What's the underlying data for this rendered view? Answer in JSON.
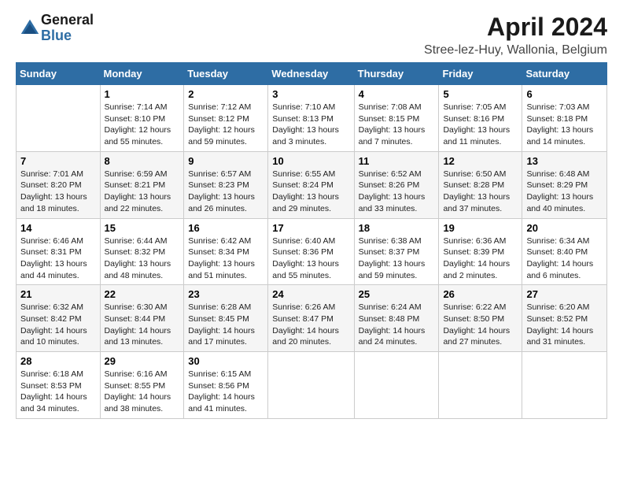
{
  "header": {
    "logo_general": "General",
    "logo_blue": "Blue",
    "title": "April 2024",
    "subtitle": "Stree-lez-Huy, Wallonia, Belgium"
  },
  "weekdays": [
    "Sunday",
    "Monday",
    "Tuesday",
    "Wednesday",
    "Thursday",
    "Friday",
    "Saturday"
  ],
  "weeks": [
    [
      {
        "day": "",
        "info": ""
      },
      {
        "day": "1",
        "info": "Sunrise: 7:14 AM\nSunset: 8:10 PM\nDaylight: 12 hours\nand 55 minutes."
      },
      {
        "day": "2",
        "info": "Sunrise: 7:12 AM\nSunset: 8:12 PM\nDaylight: 12 hours\nand 59 minutes."
      },
      {
        "day": "3",
        "info": "Sunrise: 7:10 AM\nSunset: 8:13 PM\nDaylight: 13 hours\nand 3 minutes."
      },
      {
        "day": "4",
        "info": "Sunrise: 7:08 AM\nSunset: 8:15 PM\nDaylight: 13 hours\nand 7 minutes."
      },
      {
        "day": "5",
        "info": "Sunrise: 7:05 AM\nSunset: 8:16 PM\nDaylight: 13 hours\nand 11 minutes."
      },
      {
        "day": "6",
        "info": "Sunrise: 7:03 AM\nSunset: 8:18 PM\nDaylight: 13 hours\nand 14 minutes."
      }
    ],
    [
      {
        "day": "7",
        "info": "Sunrise: 7:01 AM\nSunset: 8:20 PM\nDaylight: 13 hours\nand 18 minutes."
      },
      {
        "day": "8",
        "info": "Sunrise: 6:59 AM\nSunset: 8:21 PM\nDaylight: 13 hours\nand 22 minutes."
      },
      {
        "day": "9",
        "info": "Sunrise: 6:57 AM\nSunset: 8:23 PM\nDaylight: 13 hours\nand 26 minutes."
      },
      {
        "day": "10",
        "info": "Sunrise: 6:55 AM\nSunset: 8:24 PM\nDaylight: 13 hours\nand 29 minutes."
      },
      {
        "day": "11",
        "info": "Sunrise: 6:52 AM\nSunset: 8:26 PM\nDaylight: 13 hours\nand 33 minutes."
      },
      {
        "day": "12",
        "info": "Sunrise: 6:50 AM\nSunset: 8:28 PM\nDaylight: 13 hours\nand 37 minutes."
      },
      {
        "day": "13",
        "info": "Sunrise: 6:48 AM\nSunset: 8:29 PM\nDaylight: 13 hours\nand 40 minutes."
      }
    ],
    [
      {
        "day": "14",
        "info": "Sunrise: 6:46 AM\nSunset: 8:31 PM\nDaylight: 13 hours\nand 44 minutes."
      },
      {
        "day": "15",
        "info": "Sunrise: 6:44 AM\nSunset: 8:32 PM\nDaylight: 13 hours\nand 48 minutes."
      },
      {
        "day": "16",
        "info": "Sunrise: 6:42 AM\nSunset: 8:34 PM\nDaylight: 13 hours\nand 51 minutes."
      },
      {
        "day": "17",
        "info": "Sunrise: 6:40 AM\nSunset: 8:36 PM\nDaylight: 13 hours\nand 55 minutes."
      },
      {
        "day": "18",
        "info": "Sunrise: 6:38 AM\nSunset: 8:37 PM\nDaylight: 13 hours\nand 59 minutes."
      },
      {
        "day": "19",
        "info": "Sunrise: 6:36 AM\nSunset: 8:39 PM\nDaylight: 14 hours\nand 2 minutes."
      },
      {
        "day": "20",
        "info": "Sunrise: 6:34 AM\nSunset: 8:40 PM\nDaylight: 14 hours\nand 6 minutes."
      }
    ],
    [
      {
        "day": "21",
        "info": "Sunrise: 6:32 AM\nSunset: 8:42 PM\nDaylight: 14 hours\nand 10 minutes."
      },
      {
        "day": "22",
        "info": "Sunrise: 6:30 AM\nSunset: 8:44 PM\nDaylight: 14 hours\nand 13 minutes."
      },
      {
        "day": "23",
        "info": "Sunrise: 6:28 AM\nSunset: 8:45 PM\nDaylight: 14 hours\nand 17 minutes."
      },
      {
        "day": "24",
        "info": "Sunrise: 6:26 AM\nSunset: 8:47 PM\nDaylight: 14 hours\nand 20 minutes."
      },
      {
        "day": "25",
        "info": "Sunrise: 6:24 AM\nSunset: 8:48 PM\nDaylight: 14 hours\nand 24 minutes."
      },
      {
        "day": "26",
        "info": "Sunrise: 6:22 AM\nSunset: 8:50 PM\nDaylight: 14 hours\nand 27 minutes."
      },
      {
        "day": "27",
        "info": "Sunrise: 6:20 AM\nSunset: 8:52 PM\nDaylight: 14 hours\nand 31 minutes."
      }
    ],
    [
      {
        "day": "28",
        "info": "Sunrise: 6:18 AM\nSunset: 8:53 PM\nDaylight: 14 hours\nand 34 minutes."
      },
      {
        "day": "29",
        "info": "Sunrise: 6:16 AM\nSunset: 8:55 PM\nDaylight: 14 hours\nand 38 minutes."
      },
      {
        "day": "30",
        "info": "Sunrise: 6:15 AM\nSunset: 8:56 PM\nDaylight: 14 hours\nand 41 minutes."
      },
      {
        "day": "",
        "info": ""
      },
      {
        "day": "",
        "info": ""
      },
      {
        "day": "",
        "info": ""
      },
      {
        "day": "",
        "info": ""
      }
    ]
  ]
}
